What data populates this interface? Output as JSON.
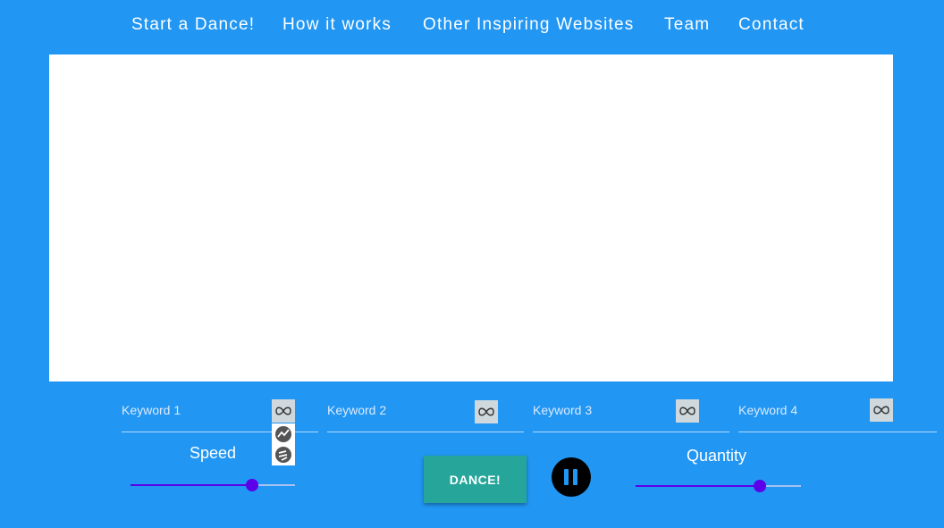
{
  "nav": {
    "items": [
      {
        "label": "Start a Dance!"
      },
      {
        "label": "How it works"
      },
      {
        "label": "Other Inspiring Websites"
      },
      {
        "label": "Team"
      },
      {
        "label": "Contact"
      }
    ]
  },
  "keywords": [
    {
      "placeholder": "Keyword 1",
      "value": ""
    },
    {
      "placeholder": "Keyword 2",
      "value": ""
    },
    {
      "placeholder": "Keyword 3",
      "value": ""
    },
    {
      "placeholder": "Keyword 4",
      "value": ""
    }
  ],
  "keyword_button_icon": "infinity-icon",
  "keyword1_options": [
    {
      "icon": "trend-line-icon"
    },
    {
      "icon": "speed-dial-icon"
    }
  ],
  "speed": {
    "label": "Speed",
    "value_fraction": 0.74
  },
  "quantity": {
    "label": "Quantity",
    "value_fraction": 0.75
  },
  "dance_button": {
    "label": "DANCE!"
  },
  "pause_button": {
    "icon": "pause-icon"
  },
  "colors": {
    "background": "#2196f3",
    "dance_button": "#26a69a",
    "slider_accent": "#5b00e8",
    "icon_button_bg": "#cfd8dc"
  }
}
